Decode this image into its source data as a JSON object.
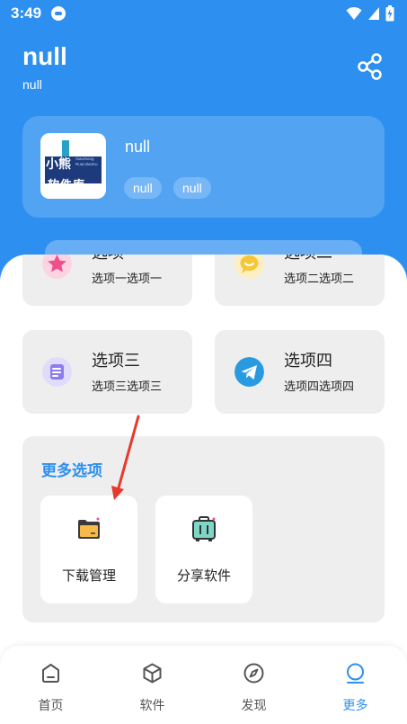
{
  "status_bar": {
    "time": "3:49"
  },
  "header": {
    "title": "null",
    "subtitle": "null"
  },
  "app_card": {
    "logo_text_main": "小熊",
    "logo_text_small_1": "XiaoXiong",
    "logo_text_small_2": "RuanJianKu",
    "logo_text_bottom": "软件库",
    "name": "null",
    "tags": [
      "null",
      "null"
    ]
  },
  "options": [
    {
      "title": "选项一",
      "subtitle": "选项一选项一",
      "icon": "star-icon",
      "color": "#f0508a"
    },
    {
      "title": "选项二",
      "subtitle": "选项二选项二",
      "icon": "chat-bubble-icon",
      "color": "#f6c63a"
    },
    {
      "title": "选项三",
      "subtitle": "选项三选项三",
      "icon": "note-icon",
      "color": "#8b7cf0"
    },
    {
      "title": "选项四",
      "subtitle": "选项四选项四",
      "icon": "telegram-icon",
      "color": "#2a9ae0"
    }
  ],
  "more_section": {
    "title": "更多选项",
    "items": [
      {
        "label": "下载管理",
        "icon": "folder-icon"
      },
      {
        "label": "分享软件",
        "icon": "suitcase-icon"
      }
    ]
  },
  "tabbar": {
    "tabs": [
      {
        "label": "首页",
        "icon": "home-icon",
        "active": false
      },
      {
        "label": "软件",
        "icon": "cube-icon",
        "active": false
      },
      {
        "label": "发现",
        "icon": "compass-icon",
        "active": false
      },
      {
        "label": "更多",
        "icon": "more-icon",
        "active": true
      }
    ]
  },
  "colors": {
    "primary": "#2d8ff0",
    "annotation_arrow": "#e53a2c"
  }
}
